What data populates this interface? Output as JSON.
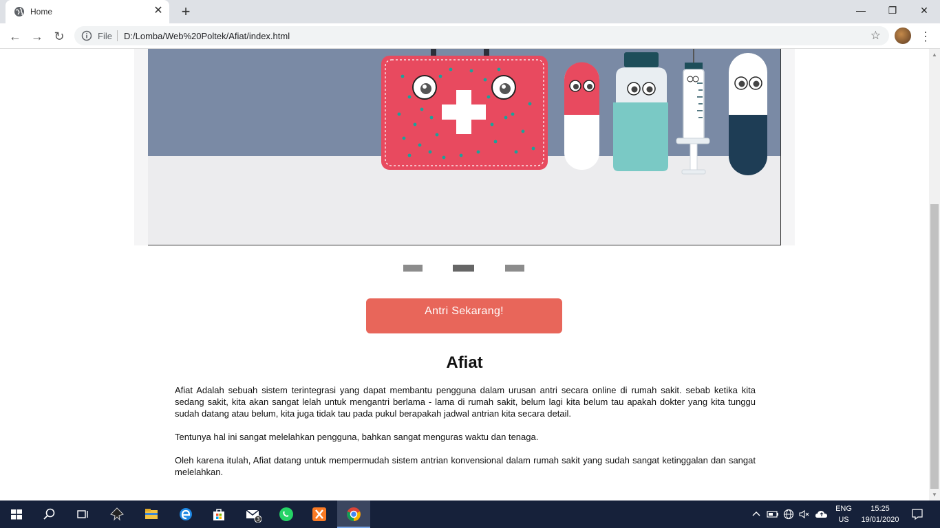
{
  "browser": {
    "tab_title": "Home",
    "url_scheme": "File",
    "url": "D:/Lomba/Web%20Poltek/Afiat/index.html"
  },
  "page": {
    "carousel": {
      "slide_count": 3,
      "active_index": 1
    },
    "cta_label": "Antri Sekarang!",
    "heading": "Afiat",
    "paragraphs": [
      "Afiat Adalah sebuah sistem terintegrasi yang dapat membantu pengguna dalam urusan antri secara online di rumah sakit. sebab ketika kita sedang sakit, kita akan sangat lelah untuk mengantri berlama - lama di rumah sakit, belum lagi kita belum tau apakah dokter yang kita tunggu sudah datang atau belum, kita juga tidak tau pada pukul berapakah jadwal antrian kita secara detail.",
      "Tentunya hal ini sangat melelahkan pengguna, bahkan sangat menguras waktu dan tenaga.",
      "Oleh karena itulah, Afiat datang untuk mempermudah sistem antrian konvensional dalam rumah sakit yang sudah sangat ketinggalan dan sangat melelahkan."
    ]
  },
  "taskbar": {
    "lang_line1": "ENG",
    "lang_line2": "US",
    "time": "15:25",
    "date": "19/01/2020",
    "mail_badge": "3"
  },
  "colors": {
    "cta": "#e8665a",
    "hero_wall": "#7a8aa5",
    "kit_red": "#e84a5f",
    "taskbar": "#16213a"
  }
}
